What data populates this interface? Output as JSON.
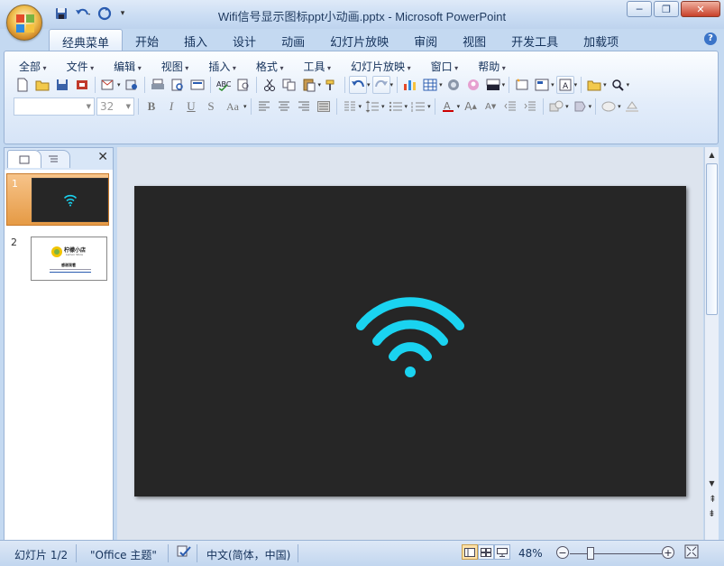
{
  "window": {
    "title": "Wifi信号显示图标ppt小动画.pptx - Microsoft PowerPoint"
  },
  "tabs": [
    "经典菜单",
    "开始",
    "插入",
    "设计",
    "动画",
    "幻灯片放映",
    "审阅",
    "视图",
    "开发工具",
    "加载项"
  ],
  "active_tab": "经典菜单",
  "menu": [
    "全部",
    "文件",
    "编辑",
    "视图",
    "插入",
    "格式",
    "工具",
    "幻灯片放映",
    "窗口",
    "帮助"
  ],
  "format": {
    "font_name": "",
    "font_size": "32"
  },
  "slides_pane": {
    "slides": [
      {
        "number": "1",
        "selected": true,
        "thumb_title": ""
      },
      {
        "number": "2",
        "selected": false,
        "thumb_title": "柠檬小店",
        "thumb_subtitle": "Lemon Store",
        "thumb_caption": "感谢观看"
      }
    ]
  },
  "slide": {
    "background": "#262626",
    "icon": "wifi-signal-icon",
    "icon_color": "#1ad3f0"
  },
  "statusbar": {
    "slide_info": "幻灯片 1/2",
    "theme": "\"Office 主题\"",
    "language": "中文(简体，中国)",
    "zoom": "48%",
    "zoom_level": 0.48
  },
  "colors": {
    "accent": "#e59a45",
    "ribbon": "#dbe7f7"
  }
}
